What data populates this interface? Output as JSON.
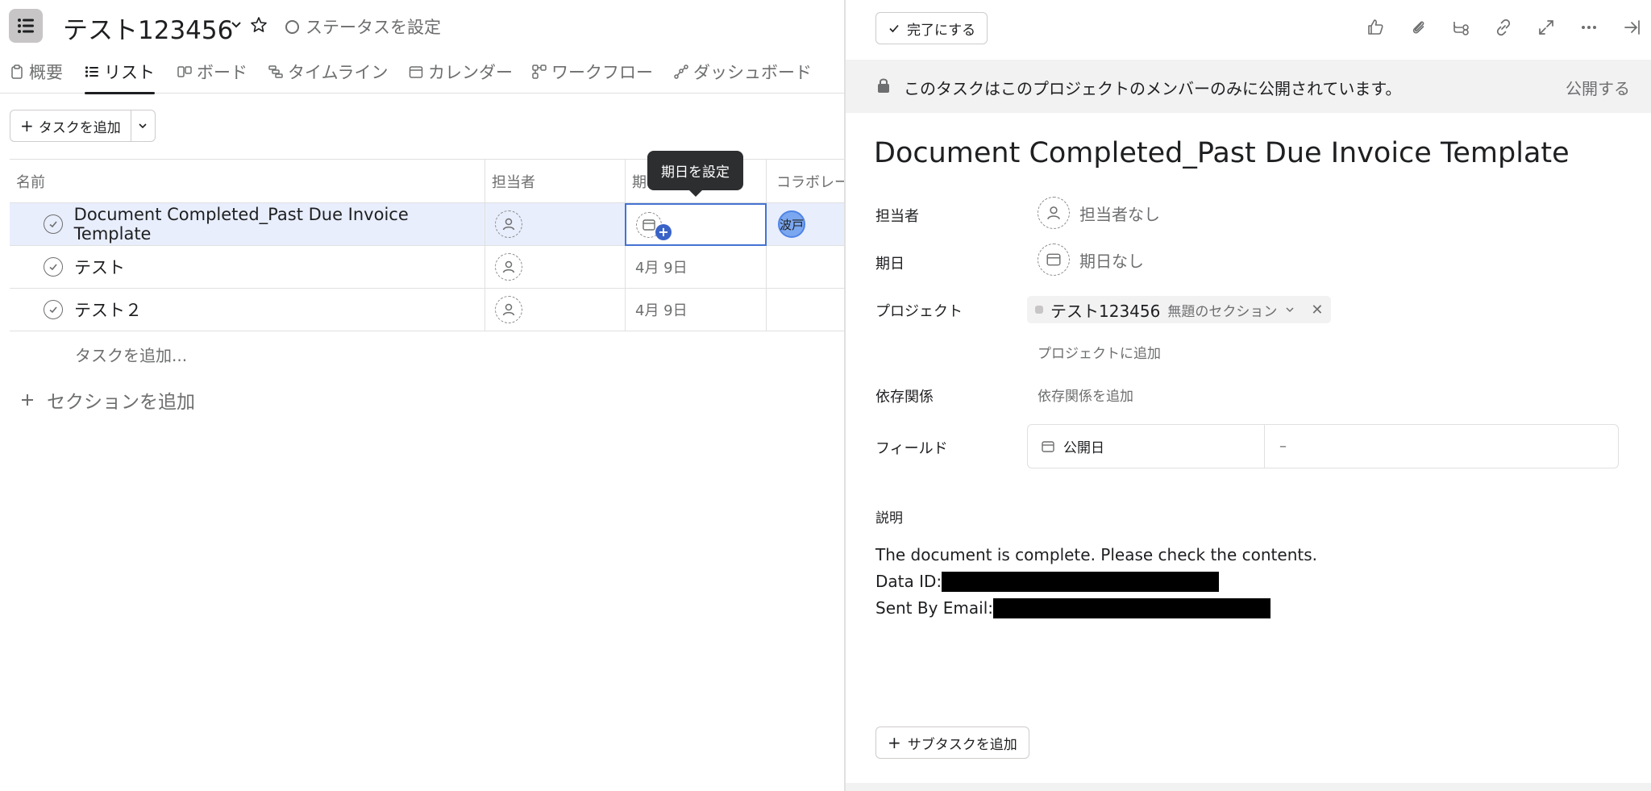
{
  "project": {
    "title": "テスト123456",
    "status_label": "ステータスを設定"
  },
  "tabs": [
    {
      "label": "概要",
      "icon": "clipboard-icon"
    },
    {
      "label": "リスト",
      "icon": "list-icon",
      "active": true
    },
    {
      "label": "ボード",
      "icon": "board-icon"
    },
    {
      "label": "タイムライン",
      "icon": "timeline-icon"
    },
    {
      "label": "カレンダー",
      "icon": "calendar-icon"
    },
    {
      "label": "ワークフロー",
      "icon": "workflow-icon"
    },
    {
      "label": "ダッシュボード",
      "icon": "dashboard-icon"
    }
  ],
  "toolbar": {
    "add_task_label": "タスクを追加"
  },
  "table": {
    "columns": [
      "名前",
      "担当者",
      "期",
      "コラボレー"
    ],
    "rows": [
      {
        "name": "Document Completed_Past Due Invoice Template",
        "due": "",
        "collaborator": "波戸",
        "selected": true
      },
      {
        "name": "テスト",
        "due": "4月 9日",
        "collaborator": ""
      },
      {
        "name": "テスト２",
        "due": "4月 9日",
        "collaborator": ""
      }
    ],
    "add_task_row": "タスクを追加...",
    "add_section": "セクションを追加"
  },
  "tooltip": "期日を設定",
  "detail": {
    "complete_label": "完了にする",
    "banner_text": "このタスクはこのプロジェクトのメンバーのみに公開されています。",
    "banner_action": "公開する",
    "title": "Document Completed_Past Due Invoice Template",
    "assignee_label": "担当者",
    "assignee_value": "担当者なし",
    "due_label": "期日",
    "due_value": "期日なし",
    "project_label": "プロジェクト",
    "project_name": "テスト123456",
    "project_section": "無題のセクション",
    "add_to_project": "プロジェクトに追加",
    "dependency_label": "依存関係",
    "dependency_action": "依存関係を追加",
    "fields_label": "フィールド",
    "field_name": "公開日",
    "field_value": "–",
    "description_label": "説明",
    "description_lines": [
      "The document is complete. Please check the contents.",
      "Data ID:",
      "Sent By Email:"
    ],
    "add_subtask": "サブタスクを追加"
  },
  "colors": {
    "selected_row": "#e8eefc",
    "focus_border": "#4573d2",
    "plus_badge": "#3a63c8",
    "avatar_fill": "#7ba7f0"
  }
}
